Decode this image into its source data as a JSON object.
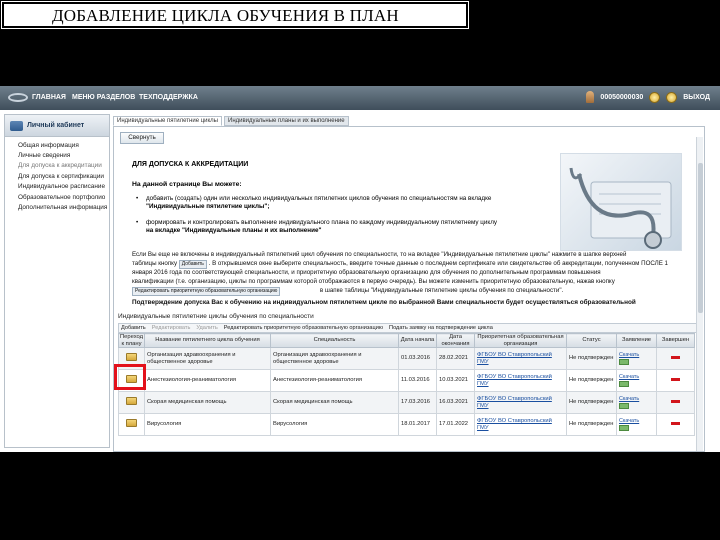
{
  "slide_title": "ДОБАВЛЕНИЕ ЦИКЛА ОБУЧЕНИЯ В ПЛАН",
  "topbar": {
    "nav": [
      "ГЛАВНАЯ",
      "МЕНЮ РАЗДЕЛОВ",
      "ТЕХПОДДЕРЖКА"
    ],
    "user_id": "00050000030",
    "logout": "ВЫХОД"
  },
  "sidebar": {
    "title": "Личный кабинет",
    "items": [
      {
        "label": "Общая информация",
        "dim": false
      },
      {
        "label": "Личные сведения",
        "dim": false
      },
      {
        "label": "Для допуска к аккредитации",
        "dim": true
      },
      {
        "label": "Для допуска к сертификации",
        "dim": false
      },
      {
        "label": "Индивидуальное расписание",
        "dim": false
      },
      {
        "label": "Образовательное портфолио",
        "dim": false
      },
      {
        "label": "Дополнительная информация",
        "dim": false
      }
    ]
  },
  "tabs": [
    "Индивидуальные пятилетние циклы",
    "Индивидуальные планы и их выполнение"
  ],
  "collapse_label": "Свернуть",
  "info": {
    "title": "ДЛЯ ДОПУСКА К АККРЕДИТАЦИИ",
    "subtitle": "На данной странице Вы можете:",
    "bullet1_line1": "добавить (создать) один или несколько индивидуальных пятилетних циклов обучения по специальностям на вкладке",
    "bullet1_line2": "\"Индивидуальные пятилетние циклы\";",
    "bullet2_line1": "формировать и контролировать выполнение индивидуального плана по каждому индивидуальному пятилетнему циклу",
    "bullet2_line2": "на вкладке \"Индивидуальные планы и их выполнение\"",
    "p1_line1": "Если Вы еще не включены в индивидуальный пятилетний цикл обучения по специальности, то на вкладке \"Индивидуальные пятилетние циклы\" нажмите в шапке верхней",
    "p1_line2_pre": "таблицы кнопку",
    "p1_button": "Добавить",
    "p1_line2_post": ". В открывшемся окне выберите специальность, введите точные данные о последнем сертификате или свидетельстве об аккредитации, полученном ПОСЛЕ 1",
    "p1_line3": "января 2016 года по соответствующей специальности, и приоритетную образовательную организацию для обучения по дополнительным программам повышения",
    "p1_line4": "квалификации (т.е. организацию, циклы по программам которой отображаются в первую очередь). Вы можете изменить приоритетную образовательную, нажав кнопку",
    "p1_button2": "Редактировать приоритетную образовательную организацию",
    "p1_line5": "в шапке таблицы \"Индивидуальные пятилетние циклы обучения по специальности\".",
    "p2": "Подтверждение допуска Вас к обучению на индивидуальном пятилетнем цикле по выбранной Вами специальности будет осуществляться образовательной"
  },
  "grid": {
    "caption": "Индивидуальные пятилетние циклы обучения по специальности",
    "toolbar": [
      {
        "label": "Добавить",
        "disabled": false
      },
      {
        "label": "Редактировать",
        "disabled": true
      },
      {
        "label": "Удалить",
        "disabled": true
      },
      {
        "label": "Редактировать приоритетную образовательную организацию",
        "disabled": false
      },
      {
        "label": "Подать заявку на подтверждение цикла",
        "disabled": false
      }
    ],
    "columns": [
      "Переход к плану",
      "Название пятилетнего цикла обучения",
      "Специальность",
      "Дата начала",
      "Дата окончания",
      "Приоритетная образовательная организация",
      "Статус",
      "Заявление",
      "Завершен"
    ],
    "rows": [
      {
        "name": "Организация здравоохранения и общественное здоровье",
        "specialty": "Организация здравоохранения и общественное здоровье",
        "start": "01.03.2016",
        "end": "28.02.2021",
        "org": "ФГБОУ ВО Ставропольский ГМУ",
        "status": "Не подтвержден",
        "download": "Скачать"
      },
      {
        "name": "Анестезиология-реаниматология",
        "specialty": "Анестезиология-реаниматология",
        "start": "11.03.2016",
        "end": "10.03.2021",
        "org": "ФГБОУ ВО Ставропольский ГМУ",
        "status": "Не подтвержден",
        "download": "Скачать"
      },
      {
        "name": "Скорая медицинская помощь",
        "specialty": "Скорая медицинская помощь",
        "start": "17.03.2016",
        "end": "16.03.2021",
        "org": "ФГБОУ ВО Ставропольский ГМУ",
        "status": "Не подтвержден",
        "download": "Скачать"
      },
      {
        "name": "Вирусология",
        "specialty": "Вирусология",
        "start": "18.01.2017",
        "end": "17.01.2022",
        "org": "ФГБОУ ВО Ставропольский ГМУ",
        "status": "Не подтвержден",
        "download": "Скачать"
      }
    ]
  },
  "icons": {
    "logo": "app-logo-icon",
    "user": "user-icon",
    "search": "search-icon",
    "settings": "gear-icon",
    "folder": "folder-icon",
    "download": "download-icon",
    "remove": "remove-icon"
  },
  "colors": {
    "highlight": "#e3111b",
    "link": "#1a4fa0",
    "remove": "#d2151b",
    "topbar": "#4e5d6a"
  }
}
